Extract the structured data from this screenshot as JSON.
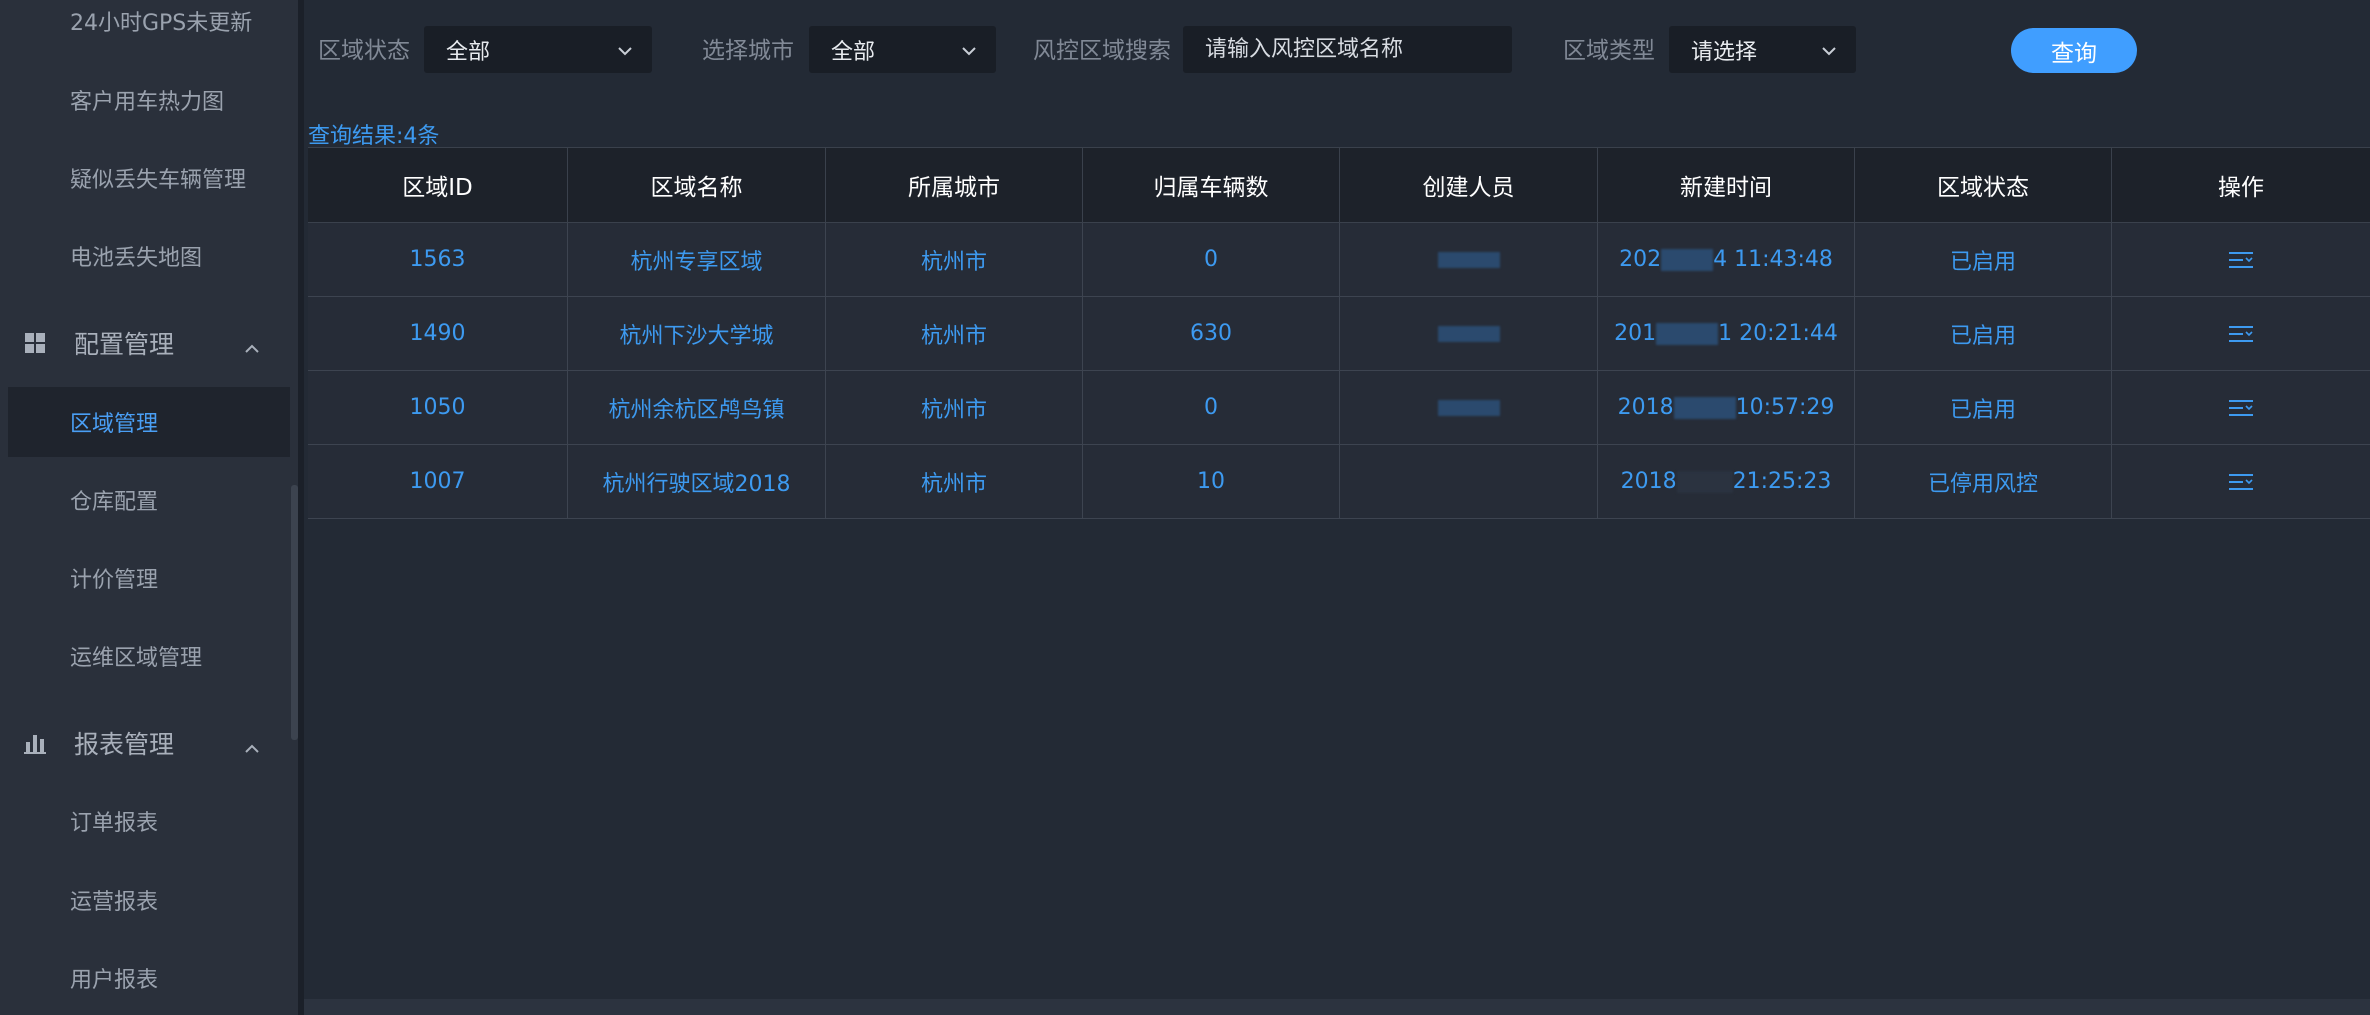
{
  "sidebar": {
    "items_top": [
      {
        "label": "24小时GPS未更新"
      },
      {
        "label": "客户用车热力图"
      },
      {
        "label": "疑似丢失车辆管理"
      },
      {
        "label": "电池丢失地图"
      }
    ],
    "group_config": {
      "label": "配置管理",
      "icon": "grid-icon"
    },
    "items_config": [
      {
        "label": "区域管理",
        "active": true
      },
      {
        "label": "仓库配置"
      },
      {
        "label": "计价管理"
      },
      {
        "label": "运维区域管理"
      }
    ],
    "group_report": {
      "label": "报表管理",
      "icon": "bar-chart-icon"
    },
    "items_report": [
      {
        "label": "订单报表"
      },
      {
        "label": "运营报表"
      },
      {
        "label": "用户报表"
      }
    ]
  },
  "filters": {
    "status_label": "区域状态",
    "status_value": "全部",
    "city_label": "选择城市",
    "city_value": "全部",
    "search_label": "风控区域搜索",
    "search_placeholder": "请输入风控区域名称",
    "type_label": "区域类型",
    "type_value": "请选择",
    "query_button": "查询"
  },
  "result_count": "查询结果:4条",
  "table": {
    "headers": [
      "区域ID",
      "区域名称",
      "所属城市",
      "归属车辆数",
      "创建人员",
      "新建时间",
      "区域状态",
      "操作"
    ],
    "rows": [
      {
        "id": "1563",
        "name": "杭州专享区域",
        "city": "杭州市",
        "vehicles": "0",
        "creator": "",
        "time_prefix": "202",
        "time_suffix": "4 11:43:48",
        "status": "已启用"
      },
      {
        "id": "1490",
        "name": "杭州下沙大学城",
        "city": "杭州市",
        "vehicles": "630",
        "creator": "",
        "time_prefix": "201",
        "time_suffix": "1 20:21:44",
        "status": "已启用"
      },
      {
        "id": "1050",
        "name": "杭州余杭区鸬鸟镇",
        "city": "杭州市",
        "vehicles": "0",
        "creator": "",
        "time_prefix": "2018",
        "time_suffix": "10:57:29",
        "status": "已启用"
      },
      {
        "id": "1007",
        "name": "杭州行驶区域2018",
        "city": "杭州市",
        "vehicles": "10",
        "creator": "",
        "time_prefix": "2018",
        "time_suffix": "21:25:23",
        "status": "已停用风控"
      }
    ]
  },
  "colors": {
    "accent": "#409eff",
    "link": "#3d9af0",
    "background": "#232a35",
    "sidebar": "#2a303b"
  }
}
